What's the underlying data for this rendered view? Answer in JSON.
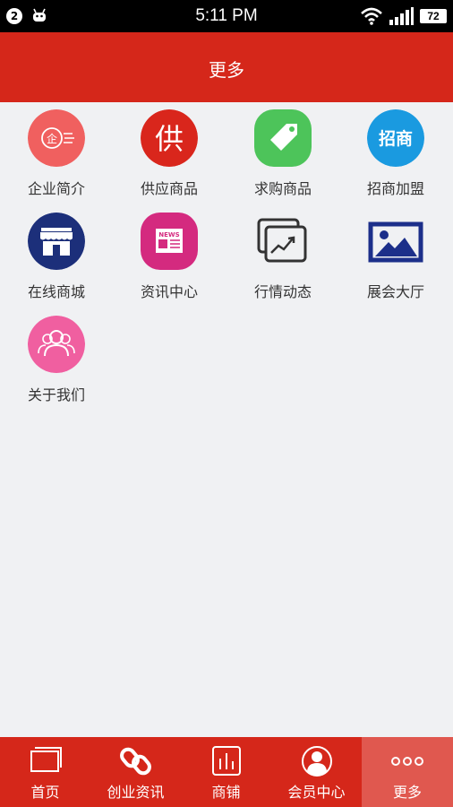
{
  "status_bar": {
    "notification_count": "2",
    "time": "5:11 PM",
    "battery": "72",
    "icons": [
      "android-icon",
      "wifi-icon",
      "signal-icon",
      "battery-icon"
    ]
  },
  "header": {
    "title": "更多"
  },
  "grid": {
    "items": [
      {
        "label": "企业简介",
        "icon": "company-profile-icon",
        "color": "#f0605f"
      },
      {
        "label": "供应商品",
        "icon": "supply-icon",
        "color": "#d9261c"
      },
      {
        "label": "求购商品",
        "icon": "price-tag-icon",
        "color": "#4dc45a"
      },
      {
        "label": "招商加盟",
        "icon": "investment-icon",
        "color": "#1a9ae0"
      },
      {
        "label": "在线商城",
        "icon": "store-icon",
        "color": "#1c2f7a"
      },
      {
        "label": "资讯中心",
        "icon": "news-icon",
        "color": "#d42a7f"
      },
      {
        "label": "行情动态",
        "icon": "trend-chart-icon",
        "color": "#333333"
      },
      {
        "label": "展会大厅",
        "icon": "image-gallery-icon",
        "color": "#1c2f8a"
      },
      {
        "label": "关于我们",
        "icon": "users-icon",
        "color": "#f05fa0"
      }
    ],
    "icon_texts": {
      "supply": "供",
      "investment": "招商",
      "news": "NEWS"
    }
  },
  "bottom_nav": {
    "items": [
      {
        "label": "首页",
        "icon": "home-icon"
      },
      {
        "label": "创业资讯",
        "icon": "link-icon"
      },
      {
        "label": "商铺",
        "icon": "shop-chart-icon"
      },
      {
        "label": "会员中心",
        "icon": "member-icon"
      },
      {
        "label": "更多",
        "icon": "more-icon"
      }
    ],
    "active_index": 4,
    "colors": {
      "background": "#d5271a",
      "active": "#e0584f"
    }
  }
}
